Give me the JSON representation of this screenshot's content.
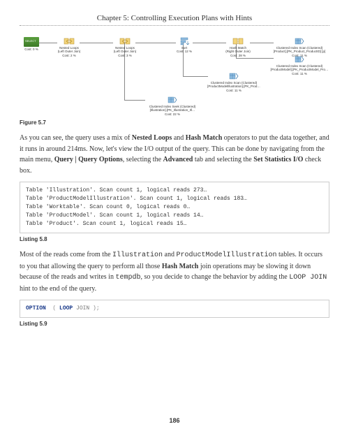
{
  "chapter_title": "Chapter 5: Controlling Execution Plans with Hints",
  "page_number": "186",
  "figure_caption": "Figure 5.7",
  "listing_caption_1": "Listing 5.8",
  "listing_caption_2": "Listing 5.9",
  "para1_part1": "As you can see, the query uses a mix of ",
  "para1_bold1": "Nested Loops",
  "para1_part2": " and ",
  "para1_bold2": "Hash Match",
  "para1_part3": " operators to put the data together, and it runs in around 214ms. Now, let's view the I/O output of the query. This can be done by navigating from the main menu, ",
  "para1_bold3": "Query | Query Options",
  "para1_part4": ", selecting the ",
  "para1_bold4": "Advanced",
  "para1_part5": " tab and selecting the ",
  "para1_bold5": "Set Statistics I/O",
  "para1_part6": " check box.",
  "code1_line1": "Table 'Illustration'. Scan count 1, logical reads 273…",
  "code1_line2": "Table 'ProductModelIllustration'. Scan count 1, logical reads 183…",
  "code1_line3": "Table 'Worktable'. Scan count 0, logical reads 0…",
  "code1_line4": "Table 'ProductModel'. Scan count 1, logical reads 14…",
  "code1_line5": "Table 'Product'. Scan count 1, logical reads 15…",
  "para2_part1": "Most of the reads come from the ",
  "para2_code1": "Illustration",
  "para2_part2": " and ",
  "para2_code2": "ProductModelIllustration",
  "para2_part3": " tables. It occurs to you that allowing the query to perform all those ",
  "para2_bold1": "Hash Match",
  "para2_part4": " join operations may be slowing it down because of the reads and writes in ",
  "para2_code3": "tempdb",
  "para2_part5": ", so you decide to change the behavior by adding the ",
  "para2_code4": "LOOP JOIN",
  "para2_part6": " hint to the end of the query.",
  "code2_kw_option": "OPTION",
  "code2_paren_open": "  ( ",
  "code2_kw_loop": "LOOP",
  "code2_kw_join": " JOIN",
  "code2_paren_close": " );",
  "plan": {
    "select": {
      "label": "Cost: 0 %"
    },
    "nested1": {
      "line1": "Nested Loops",
      "line2": "(Left Outer Join)",
      "line3": "Cost: 2 %"
    },
    "nested2": {
      "line1": "Nested Loops",
      "line2": "(Left Outer Join)",
      "line3": "Cost: 3 %"
    },
    "sort": {
      "line1": "Sort",
      "line2": "Cost: 12 %"
    },
    "hash": {
      "line1": "Hash Match",
      "line2": "(Right Outer Join)",
      "line3": "Cost: 28 %"
    },
    "cis1": {
      "line1": "Clustered Index Scan (Clustered)",
      "line2": "[Product].[PK_Product_ProductID] [p]",
      "line3": "Cost: 11 %"
    },
    "cis2": {
      "line1": "Clustered Index Scan (Clustered)",
      "line2": "[ProductModel].[PK_ProductModel_Pro…",
      "line3": "Cost: 11 %"
    },
    "cis3": {
      "line1": "Clustered Index Scan (Clustered)",
      "line2": "[ProductModelIllustration].[PK_Prod…",
      "line3": "Cost: 11 %"
    },
    "cis4": {
      "line1": "Clustered Index Seek (Clustered)",
      "line2": "[Illustration].[PK_Illustration_Ill…",
      "line3": "Cost: 22 %"
    }
  }
}
